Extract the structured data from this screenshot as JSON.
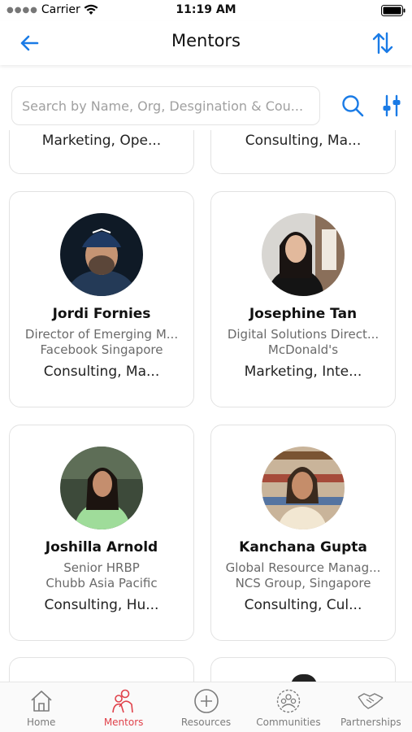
{
  "status_bar": {
    "carrier": "Carrier",
    "time": "11:19 AM"
  },
  "header": {
    "title": "Mentors"
  },
  "search": {
    "placeholder": "Search by Name, Org, Desgination & Cou..."
  },
  "colors": {
    "accent_blue": "#1a7be6",
    "active_tab": "#e0424b",
    "inactive_tab": "#7c7c7c"
  },
  "mentors_partial_top": [
    {
      "expertise": "Marketing, Ope..."
    },
    {
      "expertise": "Consulting, Ma..."
    }
  ],
  "mentors": [
    {
      "name": "Jordi Fornies",
      "designation": "Director of Emerging M...",
      "org": "Facebook Singapore",
      "expertise": "Consulting, Ma..."
    },
    {
      "name": "Josephine Tan",
      "designation": "Digital Solutions Direct...",
      "org": "McDonald's",
      "expertise": "Marketing, Inte..."
    },
    {
      "name": "Joshilla Arnold",
      "designation": "Senior HRBP",
      "org": "Chubb Asia Pacific",
      "expertise": "Consulting, Hu..."
    },
    {
      "name": "Kanchana Gupta",
      "designation": "Global Resource Manag...",
      "org": "NCS Group, Singapore",
      "expertise": "Consulting, Cul..."
    }
  ],
  "tabs": [
    {
      "label": "Home",
      "icon": "home-icon",
      "active": false
    },
    {
      "label": "Mentors",
      "icon": "mentors-icon",
      "active": true
    },
    {
      "label": "Resources",
      "icon": "plus-circle-icon",
      "active": false
    },
    {
      "label": "Communities",
      "icon": "communities-icon",
      "active": false
    },
    {
      "label": "Partnerships",
      "icon": "handshake-icon",
      "active": false
    }
  ]
}
